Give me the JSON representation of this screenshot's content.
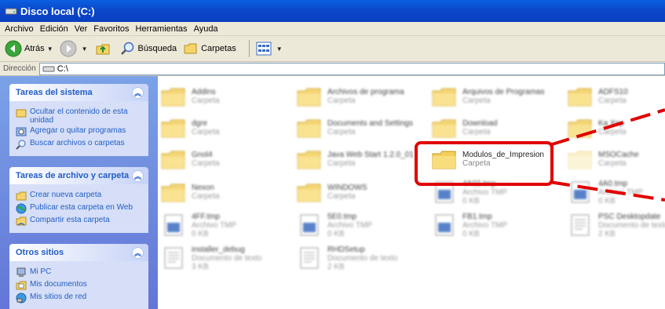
{
  "window": {
    "title": "Disco local (C:)"
  },
  "menu": [
    "Archivo",
    "Edición",
    "Ver",
    "Favoritos",
    "Herramientas",
    "Ayuda"
  ],
  "toolbar": {
    "back": "Atrás",
    "search": "Búsqueda",
    "folders": "Carpetas"
  },
  "address": {
    "label": "Dirección",
    "value": "C:\\"
  },
  "tasks": {
    "system": {
      "title": "Tareas del sistema",
      "items": [
        "Ocultar el contenido de esta unidad",
        "Agregar o quitar programas",
        "Buscar archivos o carpetas"
      ]
    },
    "file": {
      "title": "Tareas de archivo y carpeta",
      "items": [
        "Crear nueva carpeta",
        "Publicar esta carpeta en Web",
        "Compartir esta carpeta"
      ]
    },
    "other": {
      "title": "Otros sitios",
      "items": [
        "Mi PC",
        "Mis documentos",
        "Mis sitios de red"
      ]
    }
  },
  "files": [
    {
      "name": "Addins",
      "type": "Carpeta",
      "kind": "folder"
    },
    {
      "name": "Archivos de programa",
      "type": "Carpeta",
      "kind": "folder"
    },
    {
      "name": "Arquivos de Programas",
      "type": "Carpeta",
      "kind": "folder"
    },
    {
      "name": "ADFS10",
      "type": "Carpeta",
      "kind": "folder"
    },
    {
      "name": "dgre",
      "type": "Carpeta",
      "kind": "folder"
    },
    {
      "name": "Documents and Settings",
      "type": "Carpeta",
      "kind": "folder"
    },
    {
      "name": "Download",
      "type": "Carpeta",
      "kind": "folder"
    },
    {
      "name": "Ka Xep",
      "type": "Carpeta",
      "kind": "folder"
    },
    {
      "name": "Gnol4",
      "type": "Carpeta",
      "kind": "folder"
    },
    {
      "name": "Java Web Start 1.2.0_01",
      "type": "Carpeta",
      "kind": "folder"
    },
    {
      "name": "Modulos_de_Impresion",
      "type": "Carpeta",
      "kind": "folder",
      "highlighted": true
    },
    {
      "name": "MSOCache",
      "type": "Carpeta",
      "kind": "folder",
      "faded": true
    },
    {
      "name": "Nexon",
      "type": "Carpeta",
      "kind": "folder"
    },
    {
      "name": "WINDOWS",
      "type": "Carpeta",
      "kind": "folder"
    },
    {
      "name": "4A02.tmp",
      "type": "Archivo TMP",
      "size": "0 KB",
      "kind": "tmp"
    },
    {
      "name": "4A0.tmp",
      "type": "Archivo TMP",
      "size": "0 KB",
      "kind": "tmp"
    },
    {
      "name": "4FF.tmp",
      "type": "Archivo TMP",
      "size": "0 KB",
      "kind": "tmp"
    },
    {
      "name": "5E0.tmp",
      "type": "Archivo TMP",
      "size": "0 KB",
      "kind": "tmp"
    },
    {
      "name": "FB1.tmp",
      "type": "Archivo TMP",
      "size": "0 KB",
      "kind": "tmp"
    },
    {
      "name": "PSC Desktopdate",
      "type": "Documento de texto",
      "size": "2 KB",
      "kind": "txt"
    },
    {
      "name": "installer_debug",
      "type": "Documento de texto",
      "size": "3 KB",
      "kind": "txt"
    },
    {
      "name": "RHDSetup",
      "type": "Documento de texto",
      "size": "2 KB",
      "kind": "txt"
    }
  ],
  "colors": {
    "titlebar": "#0b46c9",
    "taskpane": "#7ba2e7",
    "link": "#215dc6",
    "highlight": "#e00000"
  }
}
